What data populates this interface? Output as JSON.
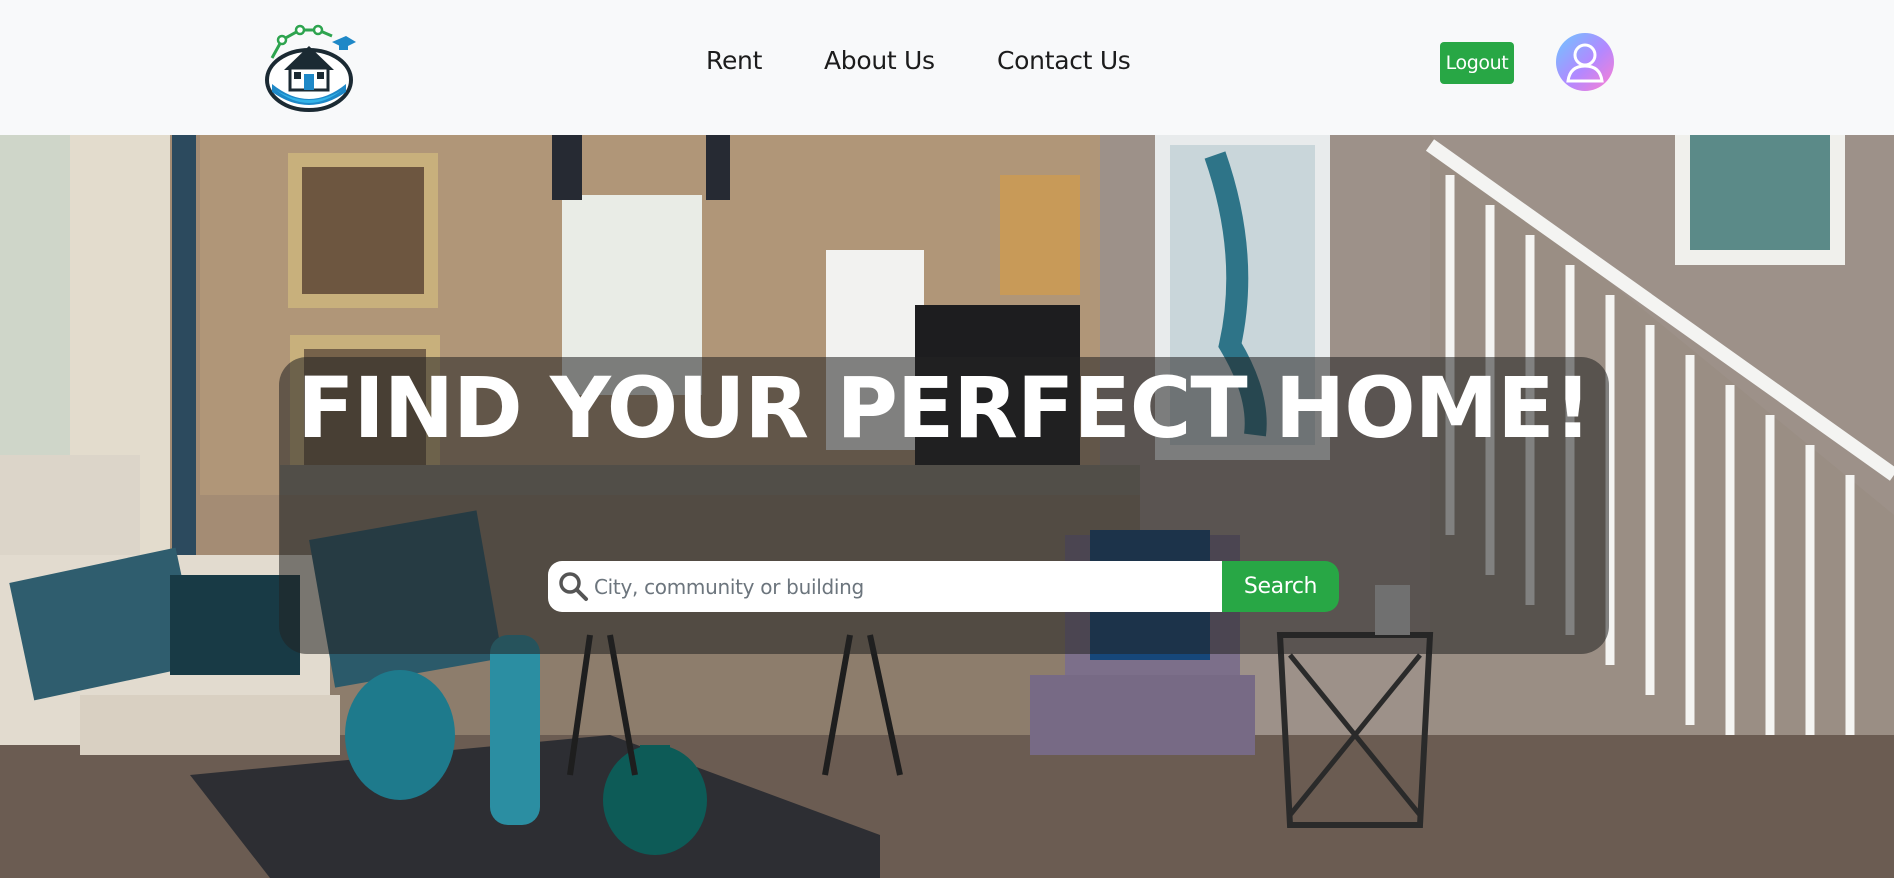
{
  "header": {
    "logo_alt": "logo",
    "nav": [
      {
        "label": "Rent"
      },
      {
        "label": "About Us"
      },
      {
        "label": "Contact Us"
      }
    ],
    "logout_label": "Logout",
    "avatar_icon": "user-avatar-icon"
  },
  "hero": {
    "title": "FIND YOUR PERFECT HOME!",
    "search": {
      "placeholder": "City, community or building",
      "value": "",
      "button_label": "Search",
      "icon": "search-icon"
    }
  },
  "colors": {
    "accent": "#28a745",
    "header_bg": "#f8f9fa",
    "overlay": "rgba(35,35,35,0.55)"
  }
}
